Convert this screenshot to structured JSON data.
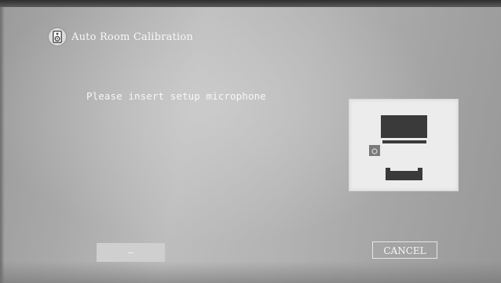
{
  "header": {
    "title": "Auto Room Calibration",
    "icon": "speaker-icon"
  },
  "main": {
    "message": "Please insert setup microphone"
  },
  "diagram": {
    "icons": [
      "tv-icon",
      "soundbar-icon",
      "microphone-port-icon",
      "sofa-icon"
    ]
  },
  "buttons": {
    "left_label": "—",
    "cancel_label": "CANCEL"
  },
  "colors": {
    "text": "#f7f7f7",
    "diagram_background": "#ececec",
    "diagram_dark": "#3a3a3a",
    "button_fill": "#cfcfcf"
  }
}
